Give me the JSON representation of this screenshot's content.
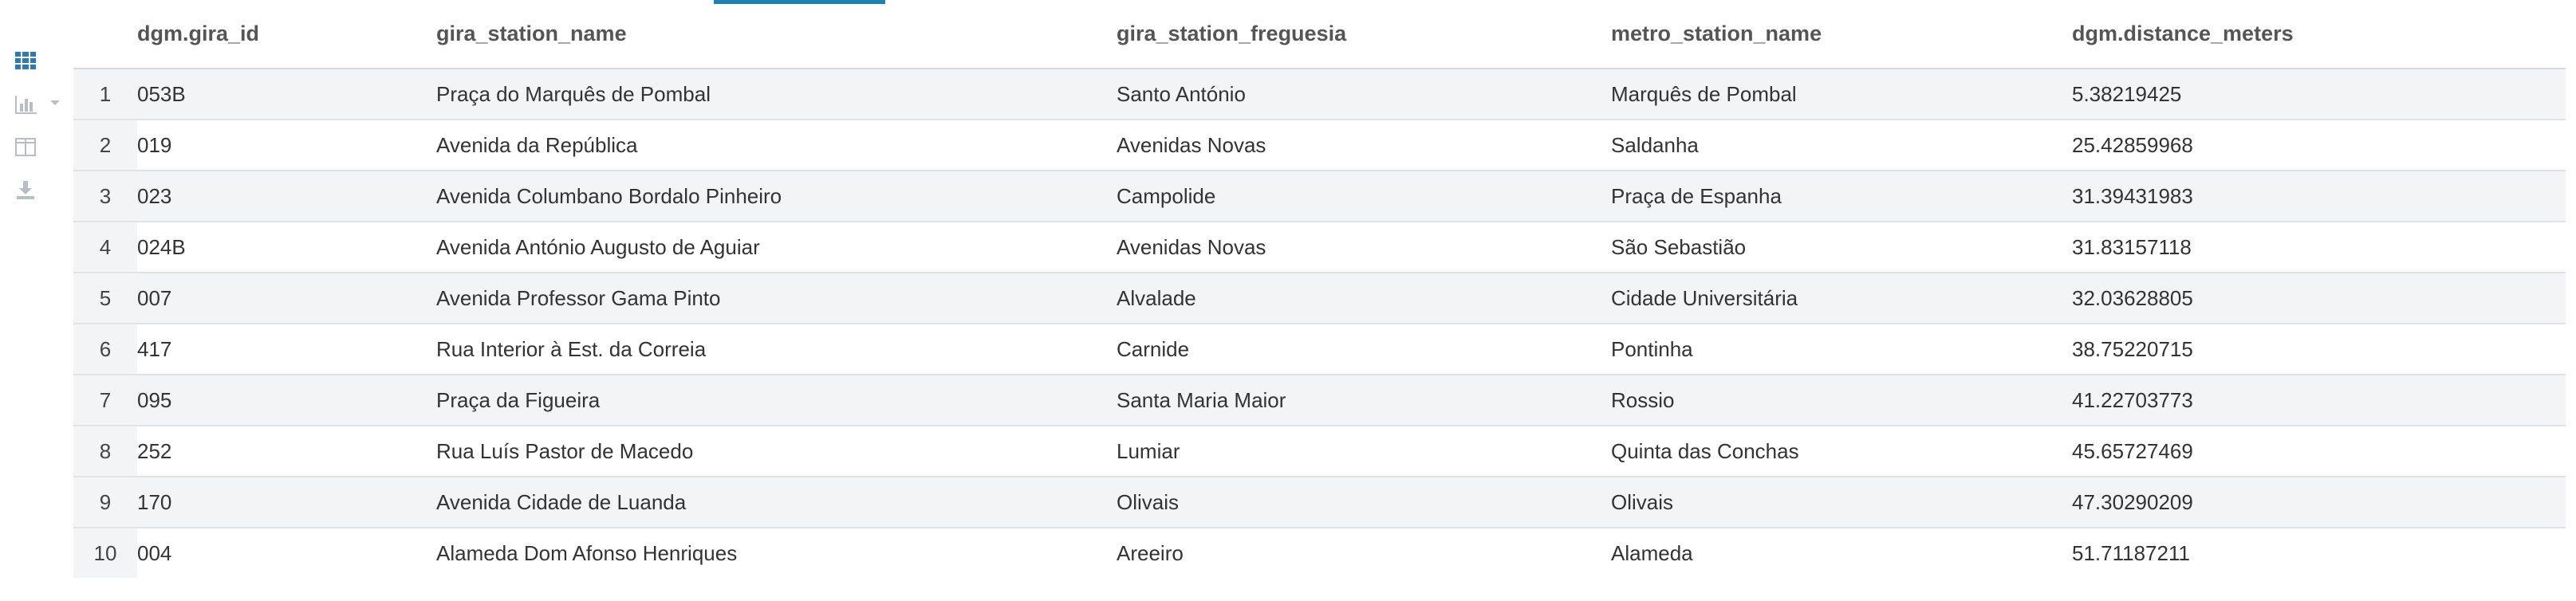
{
  "colors": {
    "accent": "#1f7fb8",
    "stripe": "#f3f4f5",
    "icon_active": "#2c7bb6",
    "icon_inactive": "#b9bec4"
  },
  "toolbar": {
    "items": [
      {
        "icon": "table-grid-icon",
        "active": true
      },
      {
        "icon": "bar-chart-icon",
        "active": false
      },
      {
        "icon": "columns-icon",
        "active": false
      },
      {
        "icon": "download-icon",
        "active": false
      }
    ]
  },
  "table": {
    "columns": [
      "dgm.gira_id",
      "gira_station_name",
      "gira_station_freguesia",
      "metro_station_name",
      "dgm.distance_meters"
    ],
    "rows": [
      {
        "index": "1",
        "cells": [
          "053B",
          "Praça do Marquês de Pombal",
          "Santo António",
          "Marquês de Pombal",
          "5.38219425"
        ]
      },
      {
        "index": "2",
        "cells": [
          "019",
          "Avenida da República",
          "Avenidas Novas",
          "Saldanha",
          "25.42859968"
        ]
      },
      {
        "index": "3",
        "cells": [
          "023",
          "Avenida Columbano Bordalo Pinheiro",
          "Campolide",
          "Praça de Espanha",
          "31.39431983"
        ]
      },
      {
        "index": "4",
        "cells": [
          "024B",
          "Avenida António Augusto de Aguiar",
          "Avenidas Novas",
          "São Sebastião",
          "31.83157118"
        ]
      },
      {
        "index": "5",
        "cells": [
          "007",
          "Avenida Professor Gama Pinto",
          "Alvalade",
          "Cidade Universitária",
          "32.03628805"
        ]
      },
      {
        "index": "6",
        "cells": [
          "417",
          "Rua Interior à Est. da Correia",
          "Carnide",
          "Pontinha",
          "38.75220715"
        ]
      },
      {
        "index": "7",
        "cells": [
          "095",
          "Praça da Figueira",
          "Santa Maria Maior",
          "Rossio",
          "41.22703773"
        ]
      },
      {
        "index": "8",
        "cells": [
          "252",
          "Rua Luís Pastor de Macedo",
          "Lumiar",
          "Quinta das Conchas",
          "45.65727469"
        ]
      },
      {
        "index": "9",
        "cells": [
          "170",
          "Avenida Cidade de Luanda",
          "Olivais",
          "Olivais",
          "47.30290209"
        ]
      },
      {
        "index": "10",
        "cells": [
          "004",
          "Alameda Dom Afonso Henriques",
          "Areeiro",
          "Alameda",
          "51.71187211"
        ]
      }
    ]
  }
}
